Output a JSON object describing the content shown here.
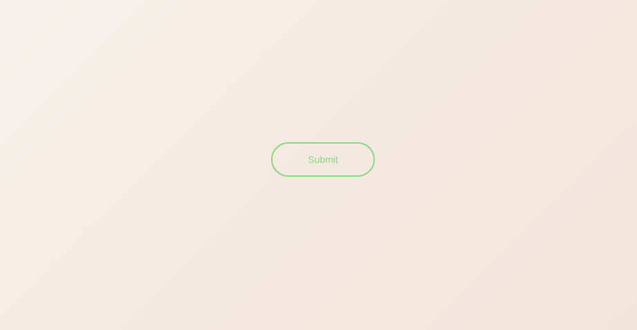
{
  "form": {
    "submit_label": "Submit"
  },
  "colors": {
    "accent": "#86d97f",
    "background_start": "#f6f0ea",
    "background_end": "#f3e5db"
  }
}
